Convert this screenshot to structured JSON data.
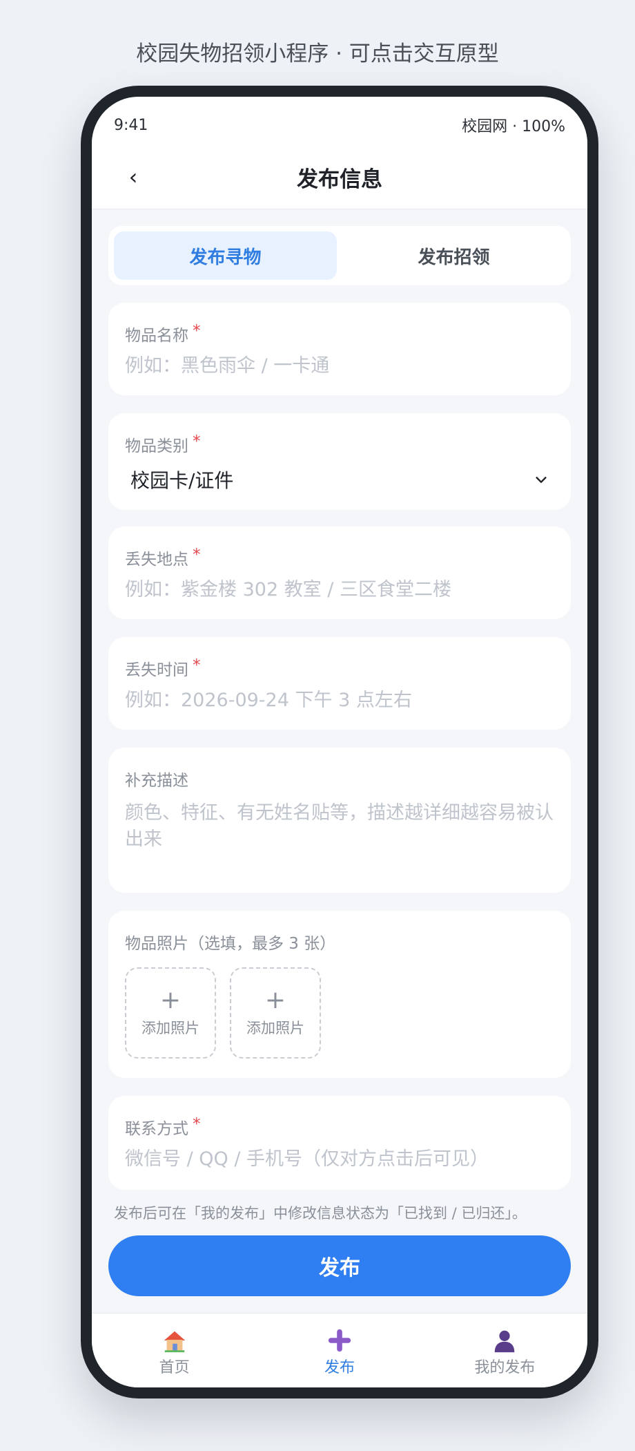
{
  "page_caption": "校园失物招领小程序 · 可点击交互原型",
  "status_bar": {
    "time": "9:41",
    "right": "校园网 · 100%"
  },
  "nav": {
    "back": "‹",
    "title": "发布信息"
  },
  "tabs": [
    {
      "label": "发布寻物",
      "active": true
    },
    {
      "label": "发布招领",
      "active": false
    }
  ],
  "form": {
    "item_name": {
      "label": "物品名称",
      "required_mark": "*",
      "placeholder": "例如：黑色雨伞 / 一卡通"
    },
    "category": {
      "label": "物品类别",
      "required_mark": "*",
      "value": "校园卡/证件"
    },
    "location": {
      "label": "丢失地点",
      "required_mark": "*",
      "placeholder": "例如：紫金楼 302 教室 / 三区食堂二楼"
    },
    "time": {
      "label": "丢失时间",
      "required_mark": "*",
      "placeholder": "例如：2026-09-24 下午 3 点左右"
    },
    "description": {
      "label": "补充描述",
      "placeholder": "颜色、特征、有无姓名贴等，描述越详细越容易被认出来"
    },
    "photos": {
      "label": "物品照片（选填，最多 3 张）",
      "slots": [
        "添加照片",
        "添加照片"
      ],
      "plus": "+"
    },
    "contact": {
      "label": "联系方式",
      "required_mark": "*",
      "placeholder": "微信号 / QQ / 手机号（仅对方点击后可见）"
    }
  },
  "hint": "发布后可在「我的发布」中修改信息状态为「已找到 / 已归还」。",
  "publish_button": "发布",
  "tabbar": [
    {
      "label": "首页",
      "icon": "house-icon",
      "active": false
    },
    {
      "label": "发布",
      "icon": "plus-cross-icon",
      "active": true
    },
    {
      "label": "我的发布",
      "icon": "user-icon",
      "active": false
    }
  ],
  "colors": {
    "accent": "#2f7ef2",
    "active_tab_bg": "#e8f1ff",
    "required": "#e5484d"
  }
}
